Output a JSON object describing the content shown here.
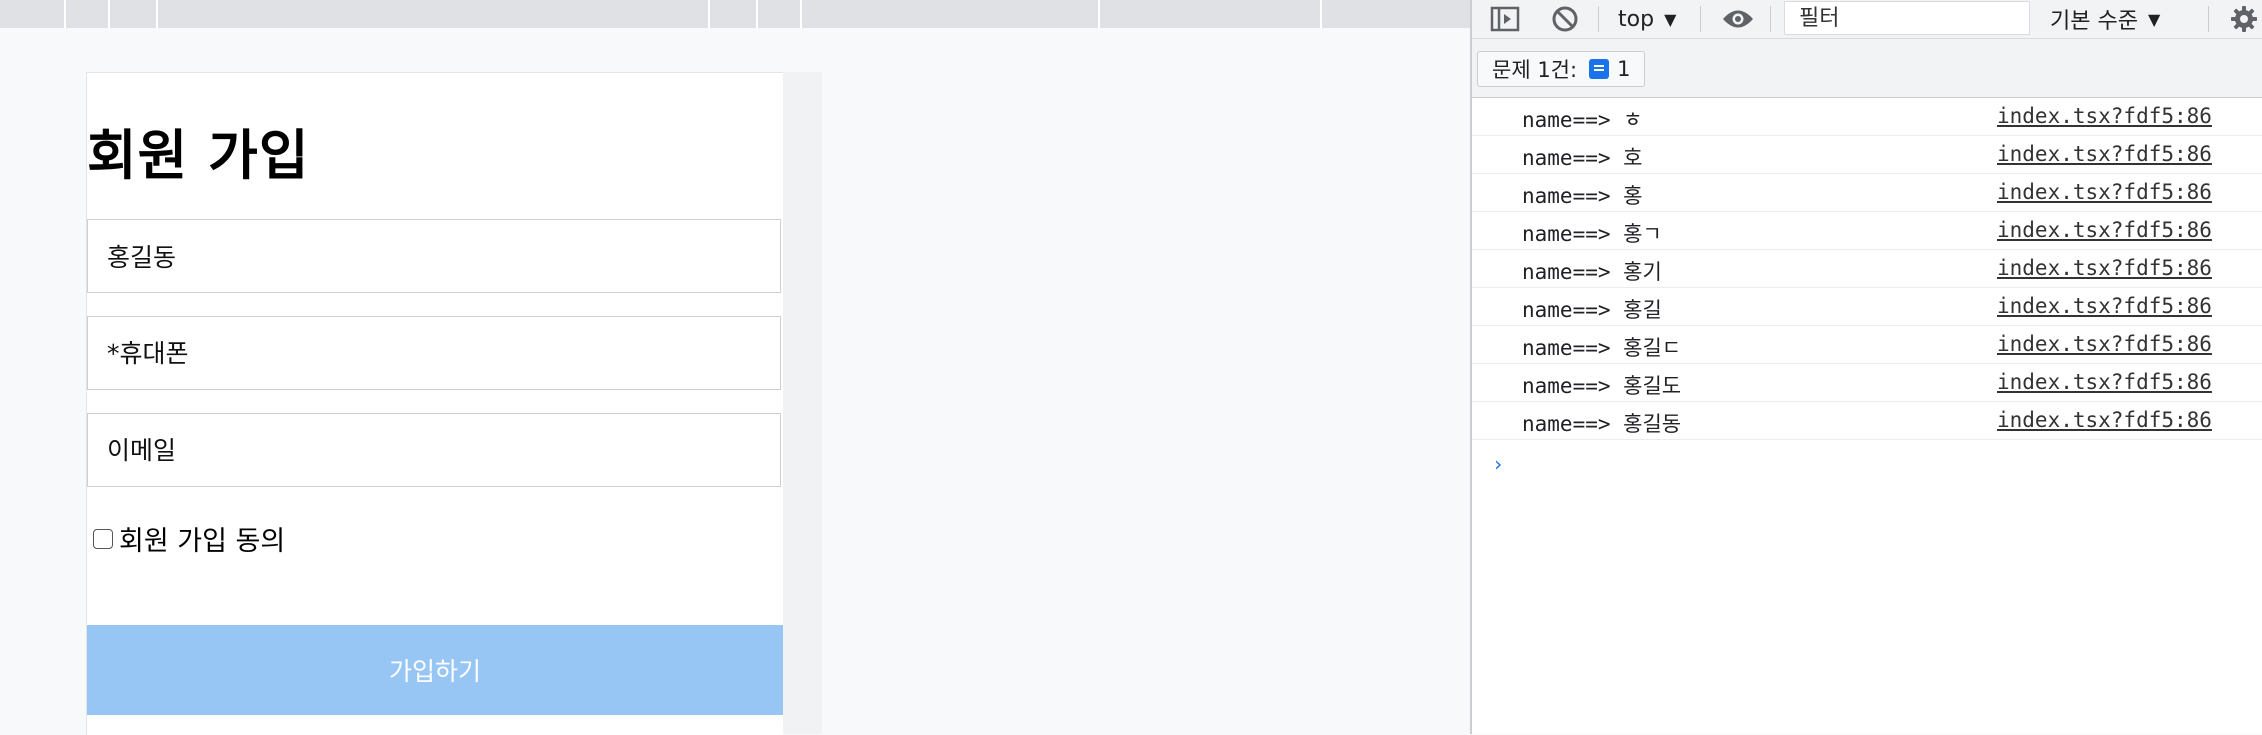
{
  "signup": {
    "title": "회원 가입",
    "name_value": "홍길동",
    "phone_placeholder": "*휴대폰",
    "email_placeholder": "이메일",
    "agree_label": "회원 가입 동의",
    "agree_checked": false,
    "submit_label": "가입하기"
  },
  "devtools": {
    "context": "top",
    "filter_placeholder": "필터",
    "level": "기본 수준",
    "issues_label": "문제 1건:",
    "issues_count": "1",
    "logs": [
      {
        "message": "name==> ㅎ",
        "source": "index.tsx?fdf5:86"
      },
      {
        "message": "name==> 호",
        "source": "index.tsx?fdf5:86"
      },
      {
        "message": "name==> 홍",
        "source": "index.tsx?fdf5:86"
      },
      {
        "message": "name==> 홍ㄱ",
        "source": "index.tsx?fdf5:86"
      },
      {
        "message": "name==> 홍기",
        "source": "index.tsx?fdf5:86"
      },
      {
        "message": "name==> 홍길",
        "source": "index.tsx?fdf5:86"
      },
      {
        "message": "name==> 홍길ㄷ",
        "source": "index.tsx?fdf5:86"
      },
      {
        "message": "name==> 홍길도",
        "source": "index.tsx?fdf5:86"
      },
      {
        "message": "name==> 홍길동",
        "source": "index.tsx?fdf5:86"
      }
    ],
    "icons": [
      "sidebar-toggle-icon",
      "clear-console-icon",
      "eye-icon",
      "gear-icon"
    ],
    "accent_color": "#1a73e8"
  },
  "colors": {
    "submit_button": "#98c6f4",
    "toolbar_bg": "#f1f3f4"
  }
}
